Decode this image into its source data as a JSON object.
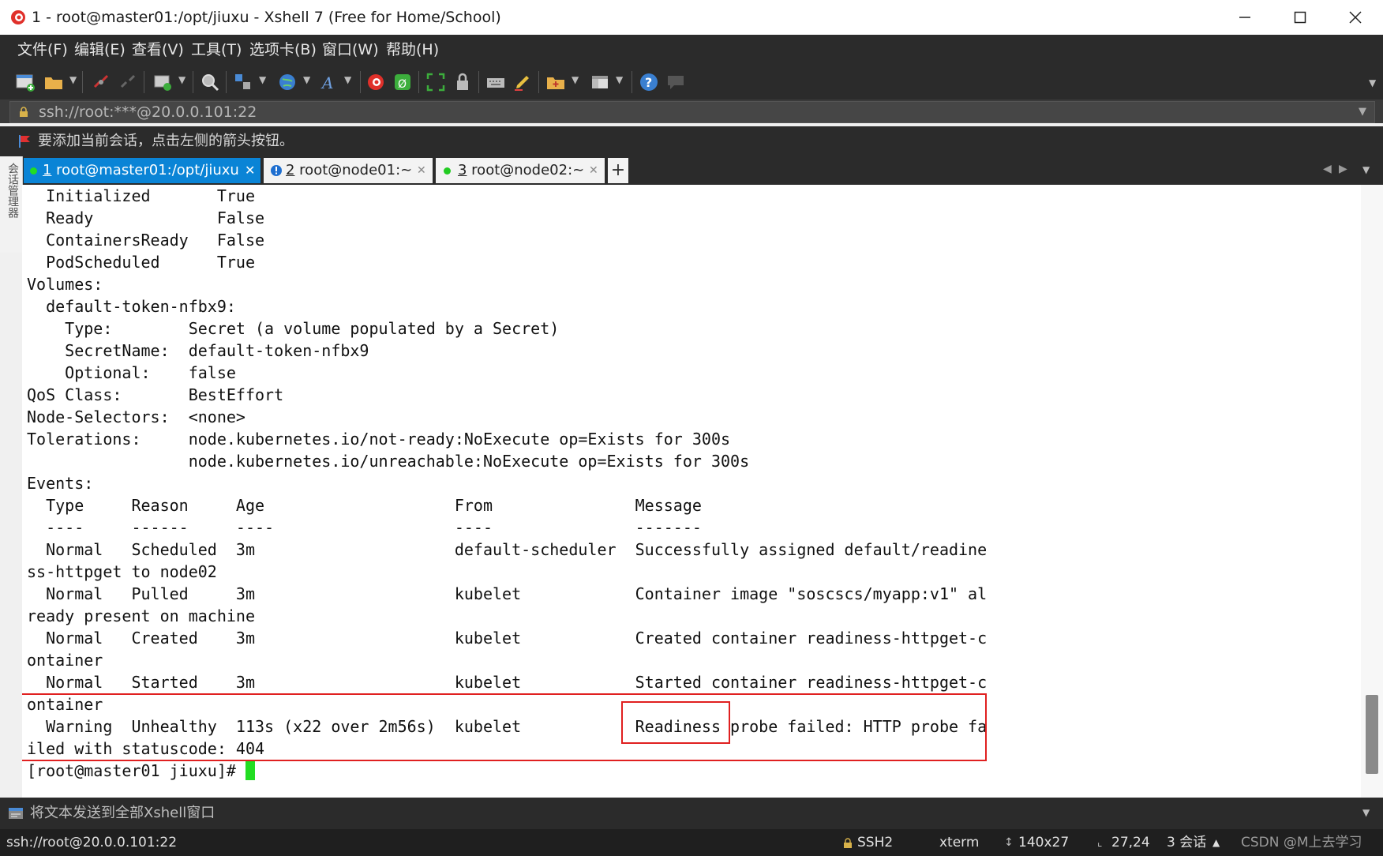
{
  "window": {
    "title": "1 - root@master01:/opt/jiuxu - Xshell 7 (Free for Home/School)"
  },
  "menu": [
    "文件(F)",
    "编辑(E)",
    "查看(V)",
    "工具(T)",
    "选项卡(B)",
    "窗口(W)",
    "帮助(H)"
  ],
  "address": {
    "value": "ssh://root:***@20.0.0.101:22"
  },
  "hint": {
    "text": "要添加当前会话，点击左侧的箭头按钮。"
  },
  "side_panel": {
    "label": "会话管理器"
  },
  "tabs": [
    {
      "num": "1",
      "label": " root@master01:/opt/jiuxu"
    },
    {
      "num": "2",
      "label": " root@node01:~"
    },
    {
      "num": "3",
      "label": " root@node02:~"
    }
  ],
  "terminal": {
    "lines": [
      "  Initialized       True ",
      "  Ready             False ",
      "  ContainersReady   False ",
      "  PodScheduled      True ",
      "Volumes:",
      "  default-token-nfbx9:",
      "    Type:        Secret (a volume populated by a Secret)",
      "    SecretName:  default-token-nfbx9",
      "    Optional:    false",
      "QoS Class:       BestEffort",
      "Node-Selectors:  <none>",
      "Tolerations:     node.kubernetes.io/not-ready:NoExecute op=Exists for 300s",
      "                 node.kubernetes.io/unreachable:NoExecute op=Exists for 300s",
      "Events:",
      "  Type     Reason     Age                    From               Message",
      "  ----     ------     ----                   ----               -------",
      "  Normal   Scheduled  3m                     default-scheduler  Successfully assigned default/readine",
      "ss-httpget to node02",
      "  Normal   Pulled     3m                     kubelet            Container image \"soscscs/myapp:v1\" al",
      "ready present on machine",
      "  Normal   Created    3m                     kubelet            Created container readiness-httpget-c",
      "ontainer",
      "  Normal   Started    3m                     kubelet            Started container readiness-httpget-c",
      "ontainer",
      "  Warning  Unhealthy  113s (x22 over 2m56s)  kubelet            Readiness probe failed: HTTP probe fa",
      "iled with statuscode: 404",
      "[root@master01 jiuxu]# "
    ]
  },
  "compose": {
    "placeholder": "将文本发送到全部Xshell窗口"
  },
  "status": {
    "connection": "ssh://root@20.0.0.101:22",
    "protocol": "SSH2",
    "term": "xterm",
    "size": "140x27",
    "cursor_pos": "27,24",
    "sessions": "3 会话",
    "watermark": "CSDN @M上去学习"
  },
  "colors": {
    "accent_tab": "#0a84d6",
    "highlight_box": "#e02020",
    "cursor": "#22dd22"
  }
}
